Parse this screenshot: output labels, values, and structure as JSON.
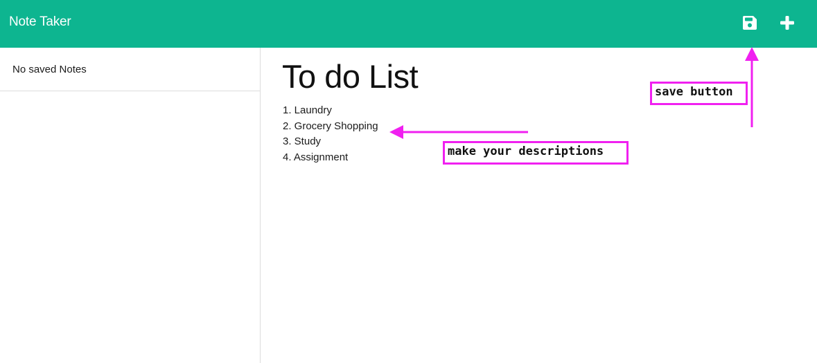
{
  "navbar": {
    "brand": "Note Taker",
    "save_icon": "floppy-disk-icon",
    "new_icon": "plus-icon",
    "background_color": "#0db590"
  },
  "sidebar": {
    "empty_message": "No saved Notes"
  },
  "note": {
    "title": "To do List",
    "lines": [
      "1. Laundry",
      "2. Grocery Shopping",
      "3. Study",
      "4. Assignment"
    ]
  },
  "annotations": {
    "save_label": "save button",
    "description_label": "make your descriptions",
    "color": "#f020f0"
  }
}
